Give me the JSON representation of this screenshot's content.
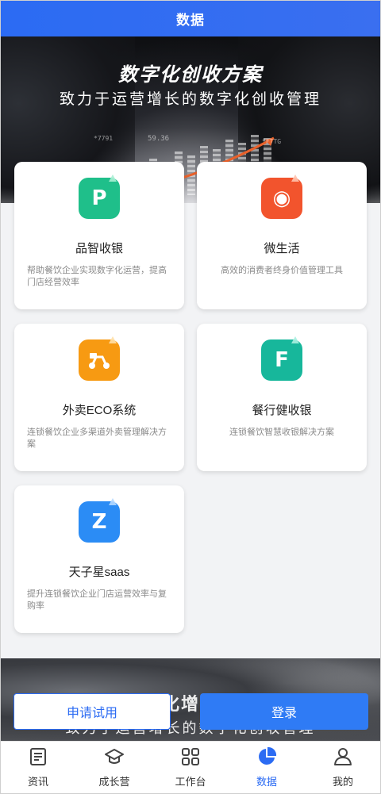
{
  "header": {
    "title": "数据"
  },
  "hero": {
    "title": "数字化创收方案",
    "subtitle": "致力于运营增长的数字化创收管理",
    "numbers": [
      "*7791",
      "59.36",
      "*FTTG"
    ]
  },
  "apps": [
    {
      "name": "品智收银",
      "desc": "帮助餐饮企业实现数字化运营，提高门店经营效率",
      "icon": "pinzhi-icon",
      "color": "#1fbf8a",
      "glyph": "P"
    },
    {
      "name": "微生活",
      "desc": "高效的消费者终身价值管理工具",
      "icon": "weishenghuo-icon",
      "color": "#f2542d",
      "glyph": "◉"
    },
    {
      "name": "外卖ECO系统",
      "desc": "连锁餐饮企业多渠道外卖管理解决方案",
      "icon": "waimai-scooter-icon",
      "color": "#f79a12",
      "glyph": "🛵"
    },
    {
      "name": "餐行健收银",
      "desc": "连锁餐饮智慧收银解决方案",
      "icon": "canxingjian-icon",
      "color": "#17b79b",
      "glyph": "F"
    },
    {
      "name": "天子星saas",
      "desc": "提升连锁餐饮企业门店运营效率与复购率",
      "icon": "tianzixing-icon",
      "color": "#2b8cf5",
      "glyph": "Z"
    }
  ],
  "banner": {
    "title": "数字化增长方案",
    "subtitle": "致力于运营增长的数字化创收管理"
  },
  "actions": {
    "trial": "申请试用",
    "login": "登录"
  },
  "tabs": [
    {
      "label": "资讯",
      "icon": "news-icon",
      "active": false
    },
    {
      "label": "成长营",
      "icon": "graduation-cap-icon",
      "active": false
    },
    {
      "label": "工作台",
      "icon": "grid-icon",
      "active": false
    },
    {
      "label": "数据",
      "icon": "pie-chart-icon",
      "active": true
    },
    {
      "label": "我的",
      "icon": "user-icon",
      "active": false
    }
  ],
  "colors": {
    "primary": "#2b6bf3",
    "active_tab": "#2b6bf3"
  }
}
